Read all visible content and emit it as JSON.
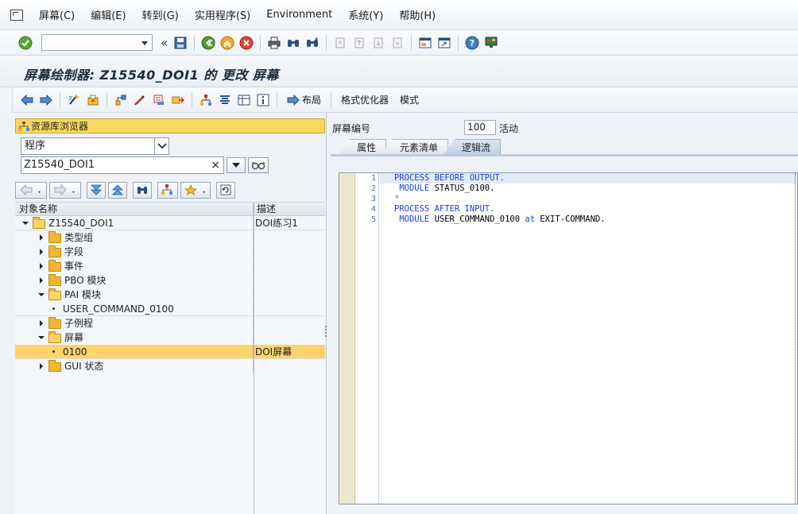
{
  "menu": {
    "items": [
      "屏幕(C)",
      "编辑(E)",
      "转到(G)",
      "实用程序(S)",
      "Environment",
      "系统(Y)",
      "帮助(H)"
    ]
  },
  "toolbar1": {
    "command_value": ""
  },
  "title": {
    "text": "屏幕绘制器: Z15540_DOI1 的 更改 屏幕"
  },
  "toolbar2": {
    "layout_label": "布局",
    "format_optimizer_label": "格式优化器",
    "mode_label": "模式"
  },
  "navigator": {
    "header": "资源库浏览器",
    "object_type": "程序",
    "object_name": "Z15540_DOI1",
    "clear_symbol": "×",
    "columns": {
      "name": "对象名称",
      "desc": "描述"
    },
    "rows": [
      {
        "label": "Z15540_DOI1",
        "desc": "DOI练习1",
        "level": 0,
        "kind": "folder-open",
        "expand": "down"
      },
      {
        "label": "类型组",
        "desc": "",
        "level": 1,
        "kind": "folder",
        "expand": "right"
      },
      {
        "label": "字段",
        "desc": "",
        "level": 1,
        "kind": "folder",
        "expand": "right"
      },
      {
        "label": "事件",
        "desc": "",
        "level": 1,
        "kind": "folder",
        "expand": "right"
      },
      {
        "label": "PBO 模块",
        "desc": "",
        "level": 1,
        "kind": "folder",
        "expand": "right"
      },
      {
        "label": "PAI 模块",
        "desc": "",
        "level": 1,
        "kind": "folder-open",
        "expand": "down"
      },
      {
        "label": "USER_COMMAND_0100",
        "desc": "",
        "level": 2,
        "kind": "leaf",
        "expand": ""
      },
      {
        "label": "子例程",
        "desc": "",
        "level": 1,
        "kind": "folder",
        "expand": "right"
      },
      {
        "label": "屏幕",
        "desc": "",
        "level": 1,
        "kind": "folder-open",
        "expand": "down"
      },
      {
        "label": "0100",
        "desc": "DOI屏幕",
        "level": 2,
        "kind": "leaf",
        "expand": "",
        "selected": true
      },
      {
        "label": "GUI 状态",
        "desc": "",
        "level": 1,
        "kind": "folder",
        "expand": "right"
      }
    ]
  },
  "screen": {
    "number_label": "屏幕编号",
    "number_value": "100",
    "status": "活动",
    "tabs": [
      "属性",
      "元素清单",
      "逻辑流"
    ],
    "active_tab": 2
  },
  "editor": {
    "line_numbers": [
      "1",
      "2",
      "3",
      "4",
      "5"
    ],
    "lines": [
      "PROCESS BEFORE OUTPUT.",
      " MODULE STATUS_0100.",
      "*",
      "PROCESS AFTER INPUT.",
      " MODULE USER_COMMAND_0100 at EXIT-COMMAND."
    ]
  },
  "colors": {
    "highlight": "#fdd36b",
    "folder": "#f4b52f",
    "keyword": "#1a3ee0"
  }
}
